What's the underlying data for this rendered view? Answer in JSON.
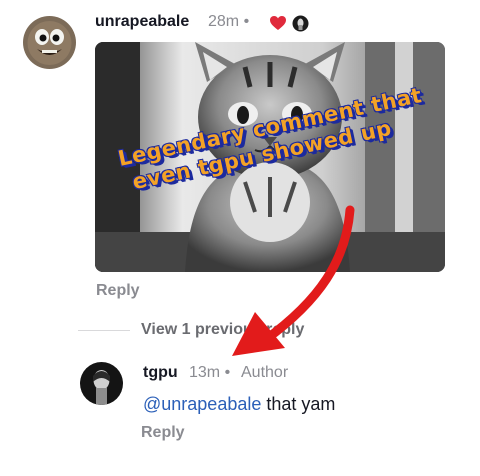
{
  "comment": {
    "username": "unrapeabale",
    "time": "28m",
    "separator": "•",
    "media_caption_lines": [
      "Legendary comment that",
      "even tgpu showed up"
    ],
    "reply_label": "Reply",
    "icons": [
      "heart-icon",
      "creator-avatar-icon"
    ],
    "accent_colors": {
      "heart": "#e02a3c",
      "caption_fill": "#f3a226",
      "caption_outline": "#1d2a9e",
      "arrow": "#e21b1b"
    }
  },
  "thread": {
    "view_replies_label": "View 1 previous reply"
  },
  "reply": {
    "username": "tgpu",
    "time": "13m",
    "separator": "•",
    "author_badge": "Author",
    "mention": "@unrapeabale",
    "text": " that yam",
    "reply_label": "Reply",
    "mention_color": "#2b5fb8"
  }
}
